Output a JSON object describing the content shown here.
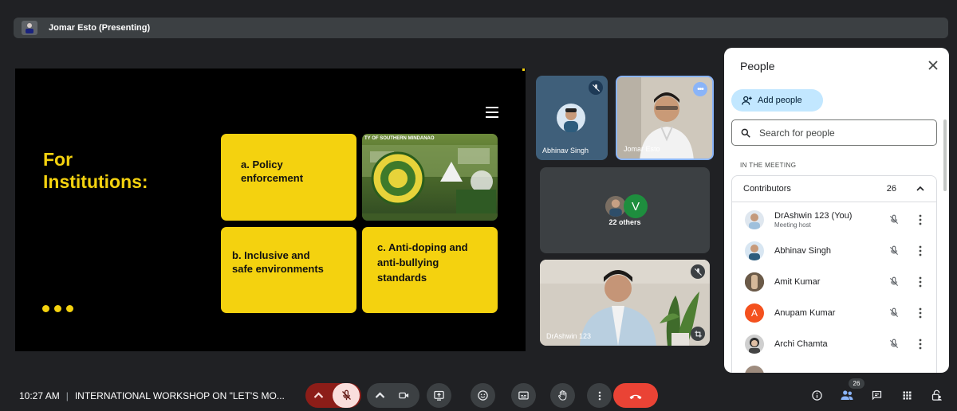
{
  "header": {
    "presenter_label": "Jomar Esto (Presenting)"
  },
  "slide": {
    "title_line1": "For",
    "title_line2": "Institutions:",
    "card_a_line1": "a. Policy",
    "card_a_line2": "enforcement",
    "card_b_line1": "b. Inclusive and",
    "card_b_line2": "safe environments",
    "card_c_line1": "c. Anti-doping and",
    "card_c_line2": "anti-bullying",
    "card_c_line3": "standards",
    "campus_label": "TY OF SOUTHERN MINDANAO",
    "accent_color": "#f4d20f"
  },
  "tiles": {
    "abhinav": "Abhinav Singh",
    "jomar": "Jomar Esto",
    "others": "22 others",
    "others_avatar_letter": "V",
    "drashwin": "DrAshwin 123"
  },
  "people_panel": {
    "title": "People",
    "add_people_label": "Add people",
    "search_placeholder": "Search for people",
    "section_label": "IN THE MEETING",
    "contributors_label": "Contributors",
    "contributors_count": "26",
    "participants": [
      {
        "name": "DrAshwin 123 (You)",
        "role": "Meeting host"
      },
      {
        "name": "Abhinav Singh"
      },
      {
        "name": "Amit Kumar"
      },
      {
        "name": "Anupam Kumar",
        "initial": "A"
      },
      {
        "name": "Archi Chamta"
      }
    ]
  },
  "bottom_bar": {
    "time": "10:27 AM",
    "separator": "|",
    "meeting_title": "INTERNATIONAL WORKSHOP ON \"LET'S MO...",
    "people_count": "26"
  },
  "colors": {
    "end_call": "#ea4335",
    "mic_off_bg": "#8c1d18",
    "panel_accent": "#c2e7ff"
  }
}
